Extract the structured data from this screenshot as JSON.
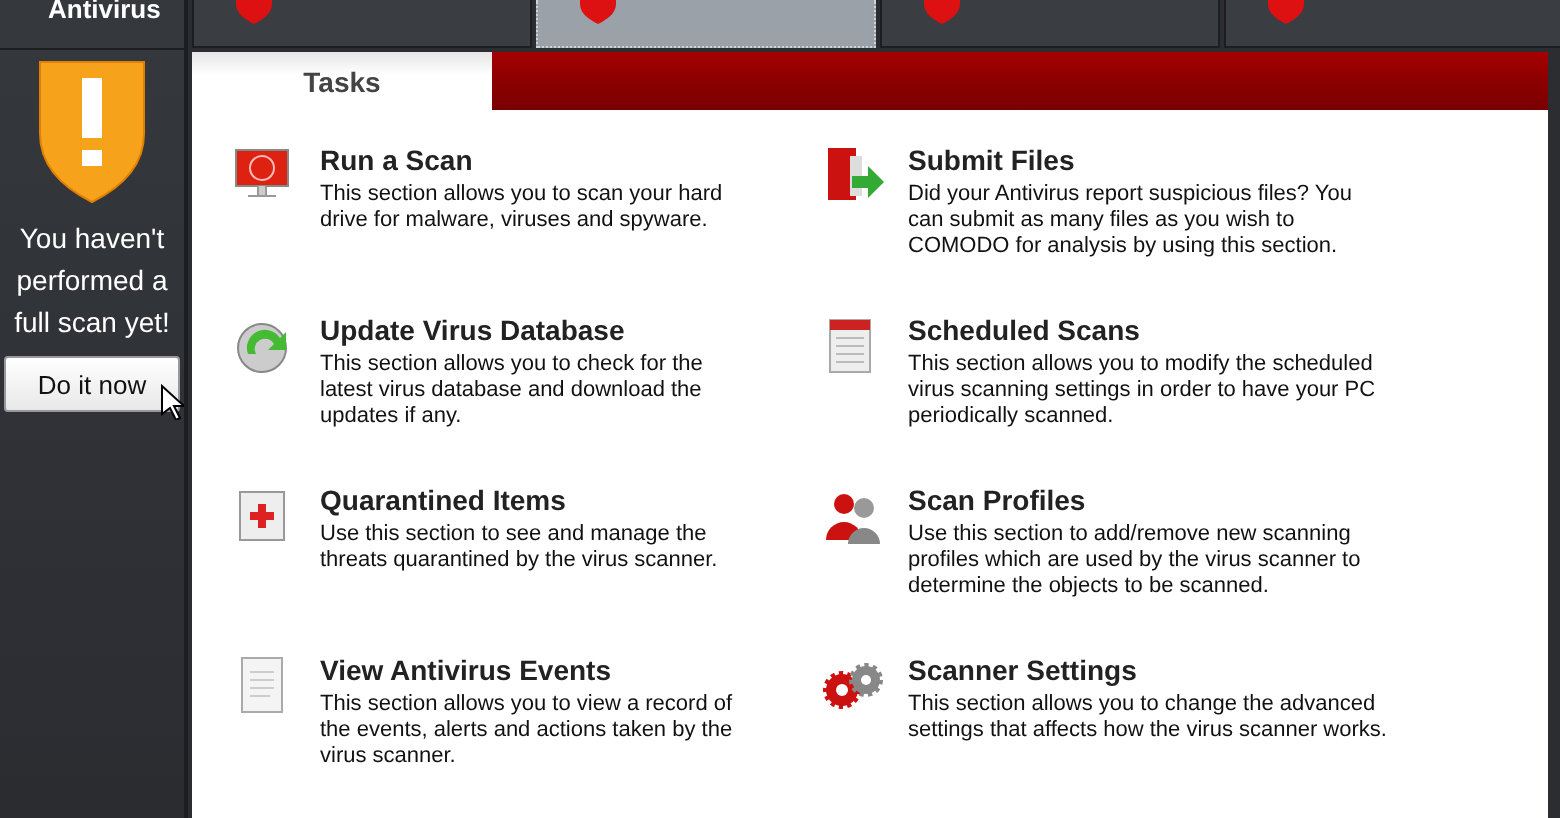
{
  "sidebar": {
    "title": "Antivirus",
    "warning": "You haven't performed a full scan yet!",
    "button": "Do it now"
  },
  "tabs": [
    {
      "selected": false
    },
    {
      "selected": true
    },
    {
      "selected": false
    },
    {
      "selected": false
    }
  ],
  "section_tab": "Tasks",
  "tasks": [
    {
      "kind": "scan",
      "title": "Run a Scan",
      "text": "This section allows you to scan your hard drive for malware, viruses and spyware."
    },
    {
      "kind": "submit",
      "title": "Submit Files",
      "text": "Did your Antivirus report suspicious files? You can submit as many files as you wish to COMODO for analysis by using this section."
    },
    {
      "kind": "update",
      "title": "Update Virus Database",
      "text": "This section allows you to check for the latest virus database and download the updates if any."
    },
    {
      "kind": "calendar",
      "title": "Scheduled Scans",
      "text": "This section allows you to modify the scheduled virus scanning settings in order to have your PC periodically scanned."
    },
    {
      "kind": "quarantine",
      "title": "Quarantined Items",
      "text": "Use this section to see and manage the threats quarantined by the virus scanner."
    },
    {
      "kind": "profiles",
      "title": "Scan Profiles",
      "text": "Use this section to add/remove new scanning profiles which are used by the virus scanner to determine the objects to be scanned."
    },
    {
      "kind": "events",
      "title": "View Antivirus Events",
      "text": "This section allows you to view a record of the events, alerts and actions taken by the virus scanner."
    },
    {
      "kind": "gears",
      "title": "Scanner Settings",
      "text": "This section allows you to change the advanced settings that affects how the virus scanner works."
    }
  ]
}
